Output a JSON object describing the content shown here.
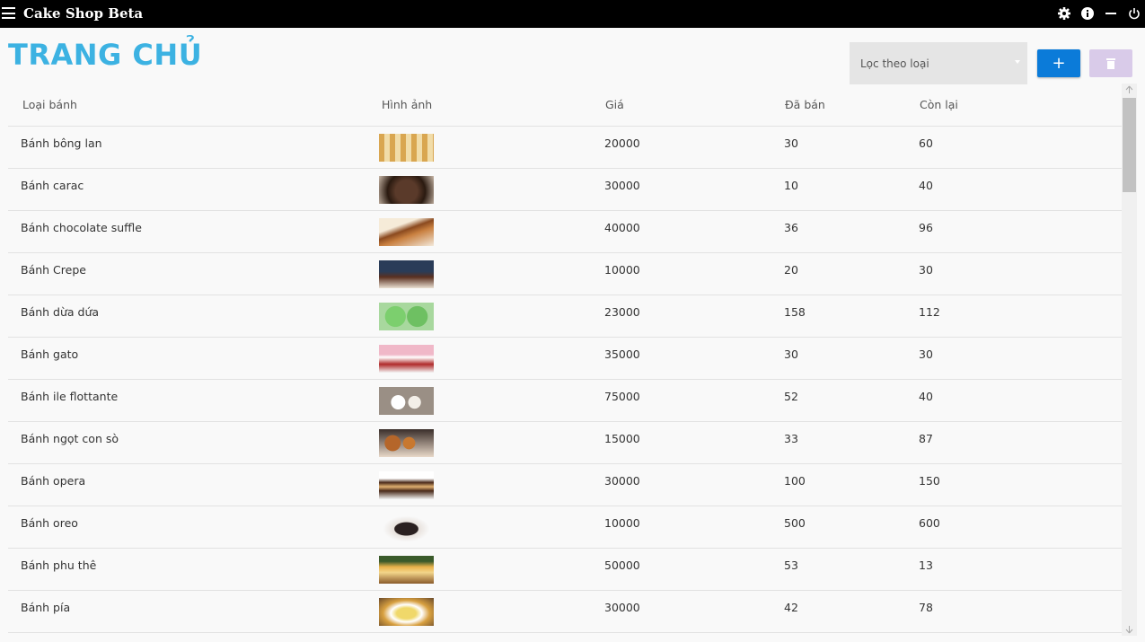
{
  "app": {
    "title": "Cake Shop Beta"
  },
  "page": {
    "title": "TRANG CHỦ"
  },
  "filter": {
    "placeholder": "Lọc theo loại"
  },
  "toolbar": {
    "add_label": "+"
  },
  "table": {
    "headers": [
      "Loại bánh",
      "Hình ảnh",
      "Giá",
      "Đã bán",
      "Còn lại"
    ],
    "rows": [
      {
        "name": "Bánh bông lan",
        "price": "20000",
        "sold": "30",
        "remaining": "60"
      },
      {
        "name": "Bánh carac",
        "price": "30000",
        "sold": "10",
        "remaining": "40"
      },
      {
        "name": "Bánh chocolate suffle",
        "price": "40000",
        "sold": "36",
        "remaining": "96"
      },
      {
        "name": "Bánh Crepe",
        "price": "10000",
        "sold": "20",
        "remaining": "30"
      },
      {
        "name": "Bánh dừa dứa",
        "price": "23000",
        "sold": "158",
        "remaining": "112"
      },
      {
        "name": "Bánh gato",
        "price": "35000",
        "sold": "30",
        "remaining": "30"
      },
      {
        "name": "Bánh ile flottante",
        "price": "75000",
        "sold": "52",
        "remaining": "40"
      },
      {
        "name": "Bánh ngọt con sò",
        "price": "15000",
        "sold": "33",
        "remaining": "87"
      },
      {
        "name": "Bánh opera",
        "price": "30000",
        "sold": "100",
        "remaining": "150"
      },
      {
        "name": "Bánh oreo",
        "price": "10000",
        "sold": "500",
        "remaining": "600"
      },
      {
        "name": "Bánh phu thê",
        "price": "50000",
        "sold": "53",
        "remaining": "13"
      },
      {
        "name": "Bánh pía",
        "price": "30000",
        "sold": "42",
        "remaining": "78"
      }
    ]
  },
  "colors": {
    "title_accent": "#3cb2e2",
    "add_button": "#0b7bd9",
    "delete_button_disabled": "#d9cbe9",
    "titlebar": "#000000"
  },
  "icons": {
    "menu": "hamburger-icon",
    "settings": "gear-icon",
    "info": "info-icon",
    "minimize": "minimize-icon",
    "power": "power-icon",
    "delete": "trash-icon"
  }
}
